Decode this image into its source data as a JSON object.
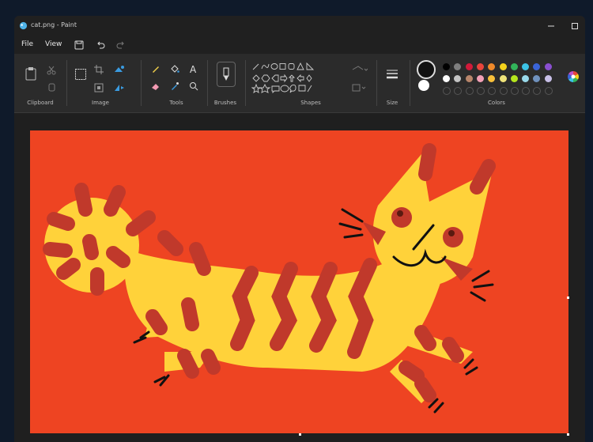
{
  "window": {
    "title": "cat.png - Paint",
    "minimize_icon": "minimize-icon",
    "maximize_icon": "maximize-icon"
  },
  "menu": {
    "file": "File",
    "view": "View"
  },
  "ribbon": {
    "clipboard": "Clipboard",
    "image": "Image",
    "tools": "Tools",
    "brushes": "Brushes",
    "shapes": "Shapes",
    "size": "Size",
    "colors": "Colors"
  },
  "colors": {
    "primary": "#111111",
    "secondary": "#ffffff",
    "row1": [
      "#000000",
      "#7f7f7f",
      "#d11a3a",
      "#e8453c",
      "#f08a2a",
      "#f4d21c",
      "#32b45a",
      "#3cc3e6",
      "#3a64d8",
      "#8a4fd0"
    ],
    "row2": [
      "#ffffff",
      "#c3c3c3",
      "#b8866b",
      "#f2a0b6",
      "#f8c03a",
      "#efe37a",
      "#b5e61d",
      "#99d9ea",
      "#7092be",
      "#c8bfe7"
    ],
    "canvas_background": "#ee4422",
    "cat_body": "#ffd23a",
    "cat_stripes": "#c0392b"
  }
}
